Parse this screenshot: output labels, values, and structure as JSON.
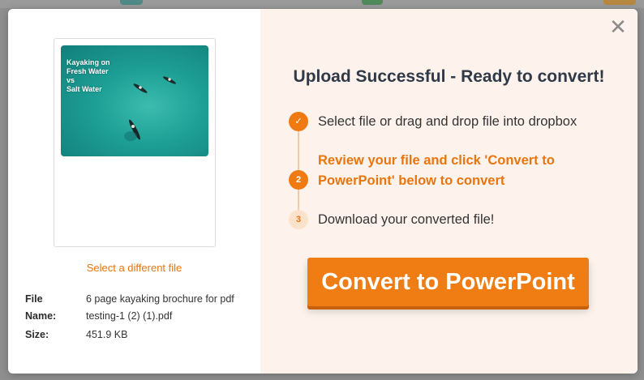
{
  "modal": {
    "close_icon": "close-icon",
    "heading": "Upload Successful - Ready to convert!",
    "preview": {
      "thumbnail_title_lines": [
        "Kayaking on",
        "Fresh Water",
        "vs",
        "Salt Water"
      ]
    },
    "select_link": "Select a different file",
    "file_name_label": "File Name:",
    "file_name_value": "6 page kayaking brochure for pdf testing-1 (2) (1).pdf",
    "size_label": "Size:",
    "size_value": "451.9 KB",
    "steps": [
      {
        "marker": "✓",
        "state": "done",
        "text": "Select file or drag and drop file into dropbox"
      },
      {
        "marker": "2",
        "state": "active",
        "text": "Review your file and click 'Convert to PowerPoint' below to convert"
      },
      {
        "marker": "3",
        "state": "pending",
        "text": "Download your converted file!"
      }
    ],
    "convert_button": "Convert to PowerPoint"
  },
  "colors": {
    "accent": "#ef7a12",
    "heading": "#2f3947",
    "right_panel_bg": "#fdf3ec"
  }
}
